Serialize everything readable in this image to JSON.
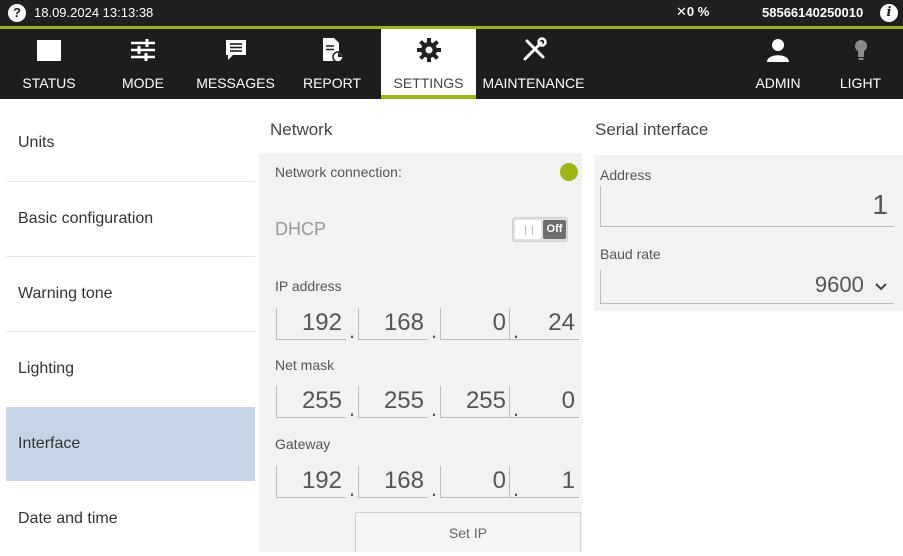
{
  "statusbar": {
    "help_icon": "?",
    "datetime": "18.09.2024 13:13:38",
    "tool_status": "✕0 %",
    "serial_number": "58566140250010",
    "info_icon": "i"
  },
  "nav": [
    {
      "label": "STATUS",
      "icon": "status-icon"
    },
    {
      "label": "MODE",
      "icon": "sliders-icon"
    },
    {
      "label": "MESSAGES",
      "icon": "message-icon"
    },
    {
      "label": "REPORT",
      "icon": "report-icon"
    },
    {
      "label": "SETTINGS",
      "icon": "gear-icon",
      "active": true
    },
    {
      "label": "MAINTENANCE",
      "icon": "tools-icon"
    },
    {
      "label": "ADMIN",
      "icon": "user-icon"
    },
    {
      "label": "LIGHT",
      "icon": "lightbulb-icon"
    }
  ],
  "menu": [
    {
      "label": "Units"
    },
    {
      "label": "Basic configuration"
    },
    {
      "label": "Warning tone"
    },
    {
      "label": "Lighting"
    },
    {
      "label": "Interface",
      "active": true
    },
    {
      "label": "Date and time"
    }
  ],
  "network": {
    "title": "Network",
    "connection_label": "Network connection:",
    "dhcp_label": "DHCP",
    "dhcp_state": "Off",
    "ip_label": "IP address",
    "ip": [
      "192",
      "168",
      "0",
      "24"
    ],
    "mask_label": "Net mask",
    "mask": [
      "255",
      "255",
      "255",
      "0"
    ],
    "gateway_label": "Gateway",
    "gateway": [
      "192",
      "168",
      "0",
      "1"
    ],
    "set_ip_label": "Set IP"
  },
  "serial": {
    "title": "Serial interface",
    "address_label": "Address",
    "address_value": "1",
    "baud_label": "Baud rate",
    "baud_value": "9600"
  },
  "colors": {
    "accent": "#9ab51c",
    "menu_active": "#c5d5e6",
    "nav_bg": "#1d1d1d"
  }
}
